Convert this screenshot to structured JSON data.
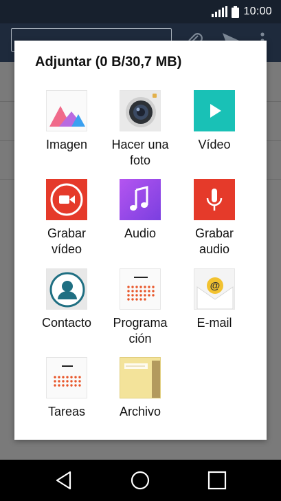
{
  "status_bar": {
    "time": "10:00"
  },
  "dialog": {
    "title": "Adjuntar (0 B/30,7 MB)",
    "options": [
      {
        "label": "Imagen",
        "icon": "gallery-icon"
      },
      {
        "label": "Hacer una\nfoto",
        "icon": "camera-icon"
      },
      {
        "label": "Vídeo",
        "icon": "video-icon"
      },
      {
        "label": "Grabar\nvídeo",
        "icon": "record-video-icon"
      },
      {
        "label": "Audio",
        "icon": "audio-icon"
      },
      {
        "label": "Grabar\naudio",
        "icon": "record-audio-icon"
      },
      {
        "label": "Contacto",
        "icon": "contact-icon"
      },
      {
        "label": "Programa\nción",
        "icon": "calendar-icon"
      },
      {
        "label": "E-mail",
        "icon": "email-icon"
      },
      {
        "label": "Tareas",
        "icon": "tasks-icon"
      },
      {
        "label": "Archivo",
        "icon": "file-folder-icon"
      }
    ]
  },
  "colors": {
    "video_teal": "#19c1b6",
    "record_red": "#e53a2a",
    "audio_purple": "#9b4de6",
    "status_bar": "#17202d"
  }
}
